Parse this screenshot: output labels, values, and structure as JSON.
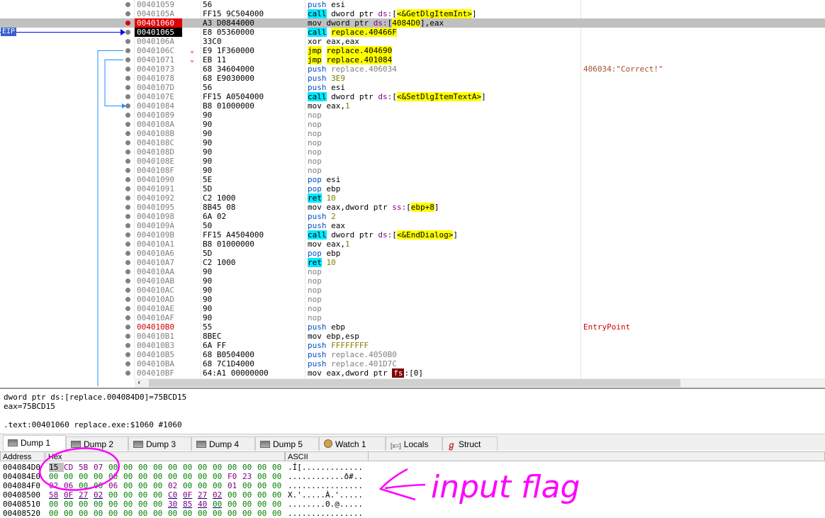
{
  "eip_label": "EIP",
  "rows": [
    {
      "addr": "00401059",
      "bytes": "56",
      "mn": "push",
      "mnc": "push",
      "ops": [
        {
          "t": "esi",
          "c": "reg"
        }
      ],
      "style": ""
    },
    {
      "addr": "0040105A",
      "bytes": "FF15 9C504000",
      "mn": "call",
      "mnc": "call",
      "ops": [
        {
          "t": "dword ptr ",
          "c": "reg"
        },
        {
          "t": "ds:",
          "c": "seg"
        },
        {
          "t": "[",
          "c": "reg"
        },
        {
          "t": "<&GetDlgItemInt>",
          "c": "sym"
        },
        {
          "t": "]",
          "c": "reg"
        }
      ],
      "style": ""
    },
    {
      "addr": "00401060",
      "bytes": "A3 D0844000",
      "mn": "mov",
      "mnc": "mov",
      "ops": [
        {
          "t": "dword ptr ",
          "c": "reg"
        },
        {
          "t": "ds:",
          "c": "seg"
        },
        {
          "t": "[",
          "c": "reg"
        },
        {
          "t": "4084D0",
          "c": "yel"
        },
        {
          "t": "],eax",
          "c": "reg"
        }
      ],
      "style": "bp"
    },
    {
      "addr": "00401065",
      "bytes": "E8 05360000",
      "mn": "call",
      "mnc": "call",
      "ops": [
        {
          "t": "replace.40466F",
          "c": "sym"
        }
      ],
      "style": "eip"
    },
    {
      "addr": "0040106A",
      "bytes": "33C0",
      "mn": "xor",
      "mnc": "xor",
      "ops": [
        {
          "t": "eax,eax",
          "c": "reg"
        }
      ],
      "style": ""
    },
    {
      "addr": "0040106C",
      "bytes": "E9 1F360000",
      "mn": "jmp",
      "mnc": "jmp",
      "ops": [
        {
          "t": "replace.404690",
          "c": "sym"
        }
      ],
      "style": "",
      "arrow": "⌄"
    },
    {
      "addr": "00401071",
      "bytes": "EB 11",
      "mn": "jmp",
      "mnc": "jmp",
      "ops": [
        {
          "t": "replace.401084",
          "c": "sym"
        }
      ],
      "style": "",
      "arrow": "⌄"
    },
    {
      "addr": "00401073",
      "bytes": "68 34604000",
      "mn": "push",
      "mnc": "push",
      "ops": [
        {
          "t": "replace.406034",
          "c": "dim"
        }
      ],
      "style": "",
      "cmt": "406034:\"Correct!\""
    },
    {
      "addr": "00401078",
      "bytes": "68 E9030000",
      "mn": "push",
      "mnc": "push",
      "ops": [
        {
          "t": "3E9",
          "c": "imm"
        }
      ],
      "style": ""
    },
    {
      "addr": "0040107D",
      "bytes": "56",
      "mn": "push",
      "mnc": "push",
      "ops": [
        {
          "t": "esi",
          "c": "reg"
        }
      ],
      "style": ""
    },
    {
      "addr": "0040107E",
      "bytes": "FF15 A0504000",
      "mn": "call",
      "mnc": "call",
      "ops": [
        {
          "t": "dword ptr ",
          "c": "reg"
        },
        {
          "t": "ds:",
          "c": "seg"
        },
        {
          "t": "[",
          "c": "reg"
        },
        {
          "t": "<&SetDlgItemTextA>",
          "c": "sym"
        },
        {
          "t": "]",
          "c": "reg"
        }
      ],
      "style": ""
    },
    {
      "addr": "00401084",
      "bytes": "B8 01000000",
      "mn": "mov",
      "mnc": "mov",
      "ops": [
        {
          "t": "eax,",
          "c": "reg"
        },
        {
          "t": "1",
          "c": "imm"
        }
      ],
      "style": ""
    },
    {
      "addr": "00401089",
      "bytes": "90",
      "mn": "nop",
      "mnc": "nop",
      "ops": [],
      "style": ""
    },
    {
      "addr": "0040108A",
      "bytes": "90",
      "mn": "nop",
      "mnc": "nop",
      "ops": [],
      "style": ""
    },
    {
      "addr": "0040108B",
      "bytes": "90",
      "mn": "nop",
      "mnc": "nop",
      "ops": [],
      "style": ""
    },
    {
      "addr": "0040108C",
      "bytes": "90",
      "mn": "nop",
      "mnc": "nop",
      "ops": [],
      "style": ""
    },
    {
      "addr": "0040108D",
      "bytes": "90",
      "mn": "nop",
      "mnc": "nop",
      "ops": [],
      "style": ""
    },
    {
      "addr": "0040108E",
      "bytes": "90",
      "mn": "nop",
      "mnc": "nop",
      "ops": [],
      "style": ""
    },
    {
      "addr": "0040108F",
      "bytes": "90",
      "mn": "nop",
      "mnc": "nop",
      "ops": [],
      "style": ""
    },
    {
      "addr": "00401090",
      "bytes": "5E",
      "mn": "pop",
      "mnc": "pop",
      "ops": [
        {
          "t": "esi",
          "c": "reg"
        }
      ],
      "style": ""
    },
    {
      "addr": "00401091",
      "bytes": "5D",
      "mn": "pop",
      "mnc": "pop",
      "ops": [
        {
          "t": "ebp",
          "c": "reg"
        }
      ],
      "style": ""
    },
    {
      "addr": "00401092",
      "bytes": "C2 1000",
      "mn": "ret",
      "mnc": "ret",
      "ops": [
        {
          "t": "10",
          "c": "imm"
        }
      ],
      "style": ""
    },
    {
      "addr": "00401095",
      "bytes": "8B45 08",
      "mn": "mov",
      "mnc": "mov",
      "ops": [
        {
          "t": "eax,dword ptr ",
          "c": "reg"
        },
        {
          "t": "ss:",
          "c": "seg"
        },
        {
          "t": "[",
          "c": "reg"
        },
        {
          "t": "ebp+8",
          "c": "yel"
        },
        {
          "t": "]",
          "c": "reg"
        }
      ],
      "style": ""
    },
    {
      "addr": "00401098",
      "bytes": "6A 02",
      "mn": "push",
      "mnc": "push",
      "ops": [
        {
          "t": "2",
          "c": "imm"
        }
      ],
      "style": ""
    },
    {
      "addr": "0040109A",
      "bytes": "50",
      "mn": "push",
      "mnc": "push",
      "ops": [
        {
          "t": "eax",
          "c": "reg"
        }
      ],
      "style": ""
    },
    {
      "addr": "0040109B",
      "bytes": "FF15 A4504000",
      "mn": "call",
      "mnc": "call",
      "ops": [
        {
          "t": "dword ptr ",
          "c": "reg"
        },
        {
          "t": "ds:",
          "c": "seg"
        },
        {
          "t": "[",
          "c": "reg"
        },
        {
          "t": "<&EndDialog>",
          "c": "sym"
        },
        {
          "t": "]",
          "c": "reg"
        }
      ],
      "style": ""
    },
    {
      "addr": "004010A1",
      "bytes": "B8 01000000",
      "mn": "mov",
      "mnc": "mov",
      "ops": [
        {
          "t": "eax,",
          "c": "reg"
        },
        {
          "t": "1",
          "c": "imm"
        }
      ],
      "style": ""
    },
    {
      "addr": "004010A6",
      "bytes": "5D",
      "mn": "pop",
      "mnc": "pop",
      "ops": [
        {
          "t": "ebp",
          "c": "reg"
        }
      ],
      "style": ""
    },
    {
      "addr": "004010A7",
      "bytes": "C2 1000",
      "mn": "ret",
      "mnc": "ret",
      "ops": [
        {
          "t": "10",
          "c": "imm"
        }
      ],
      "style": ""
    },
    {
      "addr": "004010AA",
      "bytes": "90",
      "mn": "nop",
      "mnc": "nop",
      "ops": [],
      "style": ""
    },
    {
      "addr": "004010AB",
      "bytes": "90",
      "mn": "nop",
      "mnc": "nop",
      "ops": [],
      "style": ""
    },
    {
      "addr": "004010AC",
      "bytes": "90",
      "mn": "nop",
      "mnc": "nop",
      "ops": [],
      "style": ""
    },
    {
      "addr": "004010AD",
      "bytes": "90",
      "mn": "nop",
      "mnc": "nop",
      "ops": [],
      "style": ""
    },
    {
      "addr": "004010AE",
      "bytes": "90",
      "mn": "nop",
      "mnc": "nop",
      "ops": [],
      "style": ""
    },
    {
      "addr": "004010AF",
      "bytes": "90",
      "mn": "nop",
      "mnc": "nop",
      "ops": [],
      "style": ""
    },
    {
      "addr": "004010B0",
      "bytes": "55",
      "mn": "push",
      "mnc": "push",
      "ops": [
        {
          "t": "ebp",
          "c": "reg"
        }
      ],
      "style": "ep",
      "cmt": "EntryPoint",
      "cmtRed": true
    },
    {
      "addr": "004010B1",
      "bytes": "8BEC",
      "mn": "mov",
      "mnc": "mov",
      "ops": [
        {
          "t": "ebp,esp",
          "c": "reg"
        }
      ],
      "style": ""
    },
    {
      "addr": "004010B3",
      "bytes": "6A FF",
      "mn": "push",
      "mnc": "push",
      "ops": [
        {
          "t": "FFFFFFFF",
          "c": "imm"
        }
      ],
      "style": ""
    },
    {
      "addr": "004010B5",
      "bytes": "68 B0504000",
      "mn": "push",
      "mnc": "push",
      "ops": [
        {
          "t": "replace.4050B0",
          "c": "dim"
        }
      ],
      "style": ""
    },
    {
      "addr": "004010BA",
      "bytes": "68 7C1D4000",
      "mn": "push",
      "mnc": "push",
      "ops": [
        {
          "t": "replace.401D7C",
          "c": "dim"
        }
      ],
      "style": ""
    },
    {
      "addr": "004010BF",
      "bytes": "64:A1 00000000",
      "mn": "mov",
      "mnc": "mov",
      "ops": [
        {
          "t": "eax,dword ptr ",
          "c": "reg"
        },
        {
          "t": "fs",
          "c": "fs"
        },
        {
          "t": ":[0]",
          "c": "reg"
        }
      ],
      "style": ""
    }
  ],
  "info": {
    "line1": "dword ptr ds:[replace.004084D0]=75BCD15",
    "line2": "eax=75BCD15",
    "line3": ".text:00401060 replace.exe:$1060 #1060"
  },
  "tabs": [
    {
      "label": "Dump 1",
      "icon": "dump"
    },
    {
      "label": "Dump 2",
      "icon": "dump"
    },
    {
      "label": "Dump 3",
      "icon": "dump"
    },
    {
      "label": "Dump 4",
      "icon": "dump"
    },
    {
      "label": "Dump 5",
      "icon": "dump"
    },
    {
      "label": "Watch 1",
      "icon": "watch"
    },
    {
      "label": "Locals",
      "icon": "locals",
      "iconText": "[x=]"
    },
    {
      "label": "Struct",
      "icon": "struct",
      "iconText": "ℊ"
    }
  ],
  "dump": {
    "headers": {
      "address": "Address",
      "hex": "Hex",
      "ascii": "ASCII"
    },
    "rows": [
      {
        "addr": "004084D0",
        "bytes": [
          "15",
          "CD",
          "5B",
          "07",
          "00",
          "00",
          "00",
          "00",
          "00",
          "00",
          "00",
          "00",
          "00",
          "00",
          "00",
          "00"
        ],
        "ascii": ".Í[............."
      },
      {
        "addr": "004084E0",
        "bytes": [
          "00",
          "00",
          "00",
          "00",
          "00",
          "00",
          "00",
          "00",
          "00",
          "00",
          "00",
          "00",
          "F0",
          "23",
          "00",
          "00"
        ],
        "ascii": "............ð#.."
      },
      {
        "addr": "004084F0",
        "bytes": [
          "02",
          "06",
          "00",
          "00",
          "06",
          "00",
          "00",
          "00",
          "02",
          "00",
          "00",
          "00",
          "01",
          "00",
          "00",
          "00"
        ],
        "ascii": "................"
      },
      {
        "addr": "00408500",
        "bytes": [
          "58",
          "0F",
          "27",
          "02",
          "00",
          "00",
          "00",
          "00",
          "C0",
          "0F",
          "27",
          "02",
          "00",
          "00",
          "00",
          "00"
        ],
        "ascii": "X.'.....À.'....."
      },
      {
        "addr": "00408510",
        "bytes": [
          "00",
          "00",
          "00",
          "00",
          "00",
          "00",
          "00",
          "00",
          "30",
          "85",
          "40",
          "00",
          "00",
          "00",
          "00",
          "00"
        ],
        "ascii": "........0.@....."
      },
      {
        "addr": "00408520",
        "bytes": [
          "00",
          "00",
          "00",
          "00",
          "00",
          "00",
          "00",
          "00",
          "00",
          "00",
          "00",
          "00",
          "00",
          "00",
          "00",
          "00"
        ],
        "ascii": "................"
      }
    ]
  },
  "annotation_text": "input flag"
}
